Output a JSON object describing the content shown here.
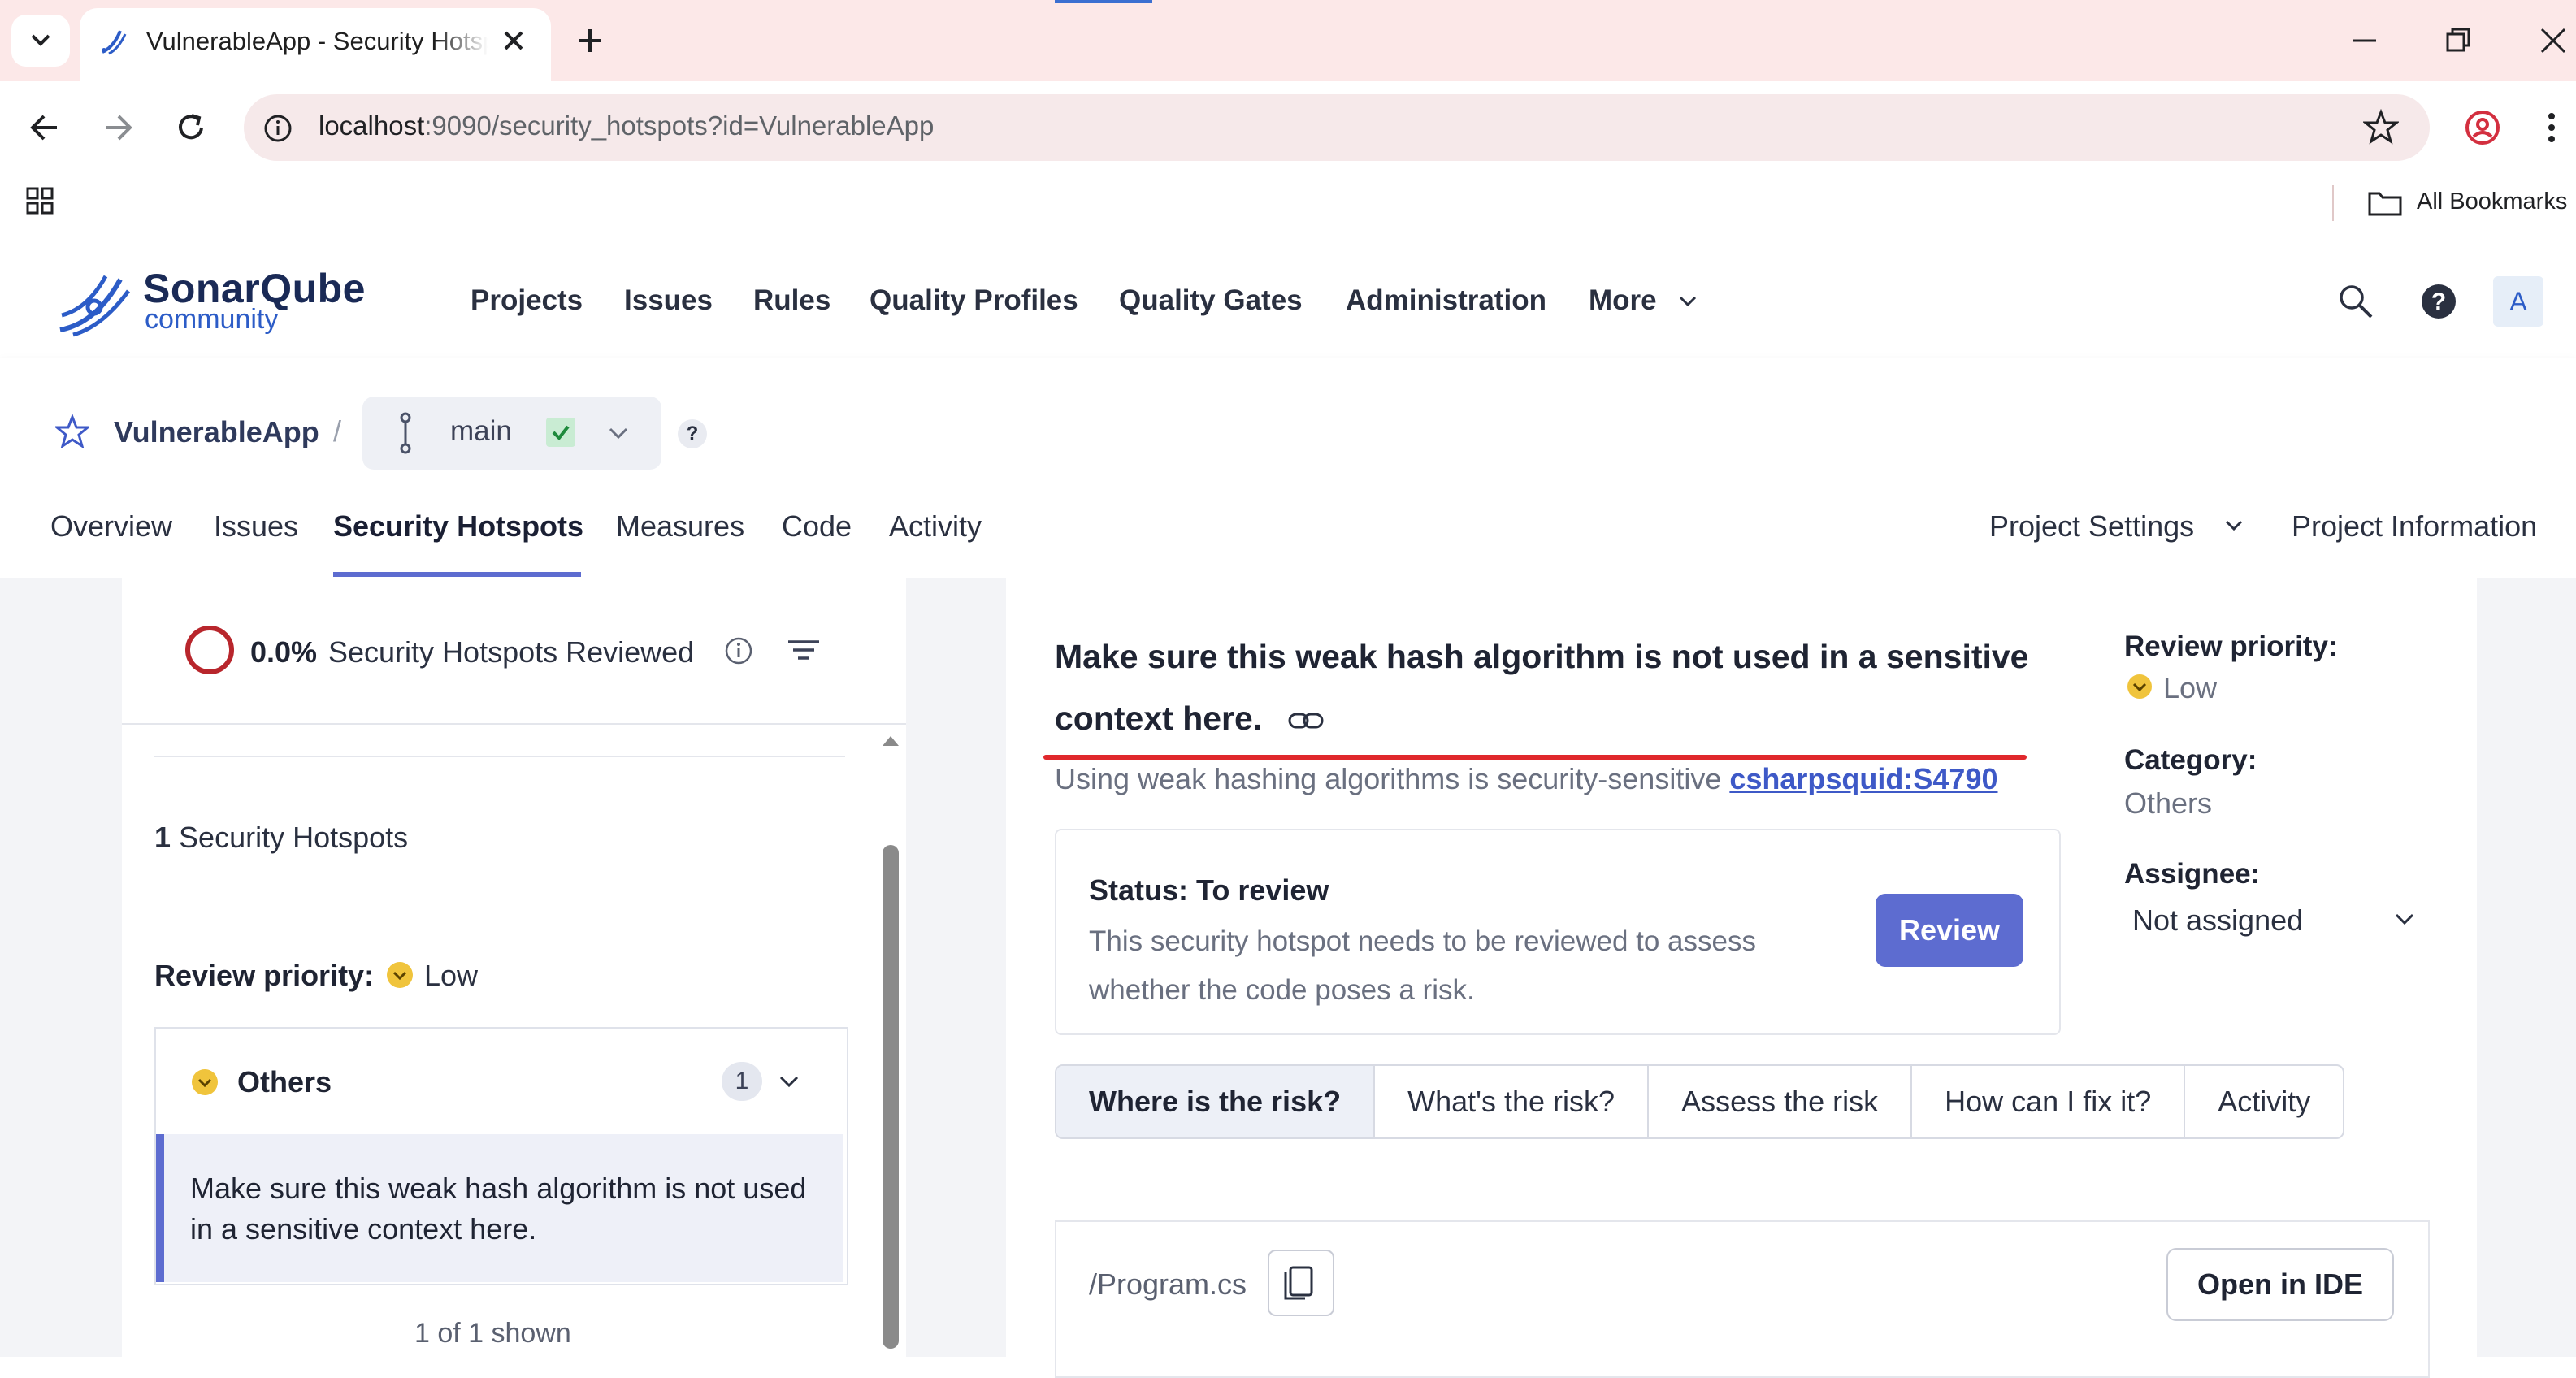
{
  "browser": {
    "tab_title": "VulnerableApp - Security Hotspots",
    "url_host": "localhost",
    "url_rest": ":9090/security_hotspots?id=VulnerableApp",
    "bookmarks_label": "All Bookmarks"
  },
  "header": {
    "logo_main": "SonarQube",
    "logo_sub": "community",
    "nav": [
      "Projects",
      "Issues",
      "Rules",
      "Quality Profiles",
      "Quality Gates",
      "Administration",
      "More"
    ],
    "avatar_letter": "A"
  },
  "project": {
    "name": "VulnerableApp",
    "separator": "/",
    "branch": "main",
    "help": "?",
    "tabs": [
      "Overview",
      "Issues",
      "Security Hotspots",
      "Measures",
      "Code",
      "Activity"
    ],
    "active_tab": "Security Hotspots",
    "settings_label": "Project Settings",
    "info_label": "Project Information"
  },
  "sidebar": {
    "reviewed_pct": "0.0%",
    "reviewed_label": "Security Hotspots Reviewed",
    "count": "1",
    "count_label": "Security Hotspots",
    "priority_label": "Review priority:",
    "priority_value": "Low",
    "group_name": "Others",
    "group_count": "1",
    "hotspot_text": "Make sure this weak hash algorithm is not used in a sensitive context here.",
    "shown": "1 of 1 shown"
  },
  "hotspot": {
    "title": "Make sure this weak hash algorithm is not used in a sensitive context here.",
    "rule_desc": "Using weak hashing algorithms is security-sensitive",
    "rule_key": "csharpsquid:S4790",
    "status_title": "Status: To review",
    "status_desc": "This security hotspot needs to be reviewed to assess whether the code poses a risk.",
    "review_button": "Review",
    "side": {
      "priority_label": "Review priority:",
      "priority_value": "Low",
      "category_label": "Category:",
      "category_value": "Others",
      "assignee_label": "Assignee:",
      "assignee_value": "Not assigned"
    },
    "risk_tabs": [
      "Where is the risk?",
      "What's the risk?",
      "Assess the risk",
      "How can I fix it?",
      "Activity"
    ],
    "file_name": "/Program.cs",
    "open_ide": "Open in IDE"
  },
  "colors": {
    "accent": "#5d6cd0",
    "brand_blue": "#2c5cc7",
    "chrome_bg": "#fce8e8",
    "red_annotation": "#e0282c",
    "priority_low": "#f0c43c"
  }
}
